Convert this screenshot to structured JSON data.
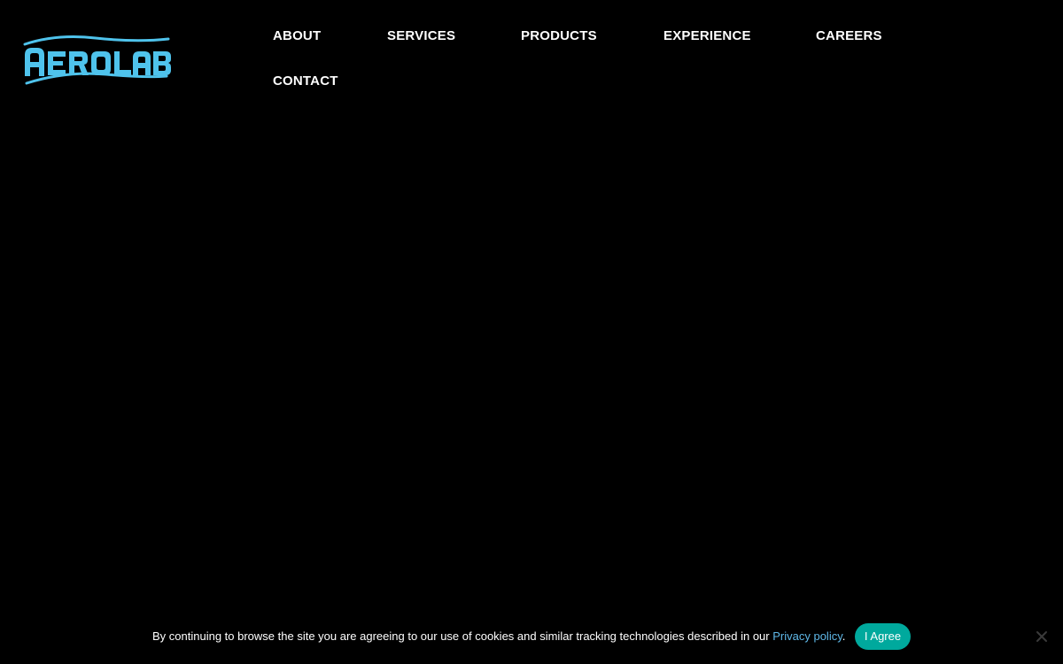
{
  "brand": {
    "logo_text": "AEROLAB",
    "logo_color": "#4fc3ec",
    "logo_icon": "aerolab-logo"
  },
  "nav": {
    "items": [
      {
        "label": "ABOUT"
      },
      {
        "label": "SERVICES"
      },
      {
        "label": "PRODUCTS"
      },
      {
        "label": "EXPERIENCE"
      },
      {
        "label": "CAREERS"
      },
      {
        "label": "CONTACT"
      }
    ]
  },
  "cookie_notice": {
    "text": "By continuing to browse the site you are agreeing to our use of cookies and similar tracking technologies described in our ",
    "link_label": "Privacy policy",
    "suffix": ".",
    "agree_label": "I Agree",
    "agree_color": "#00a99d",
    "link_color": "#5fb8e8",
    "close_icon": "close-icon"
  },
  "colors": {
    "background": "#000000",
    "text": "#ffffff"
  }
}
